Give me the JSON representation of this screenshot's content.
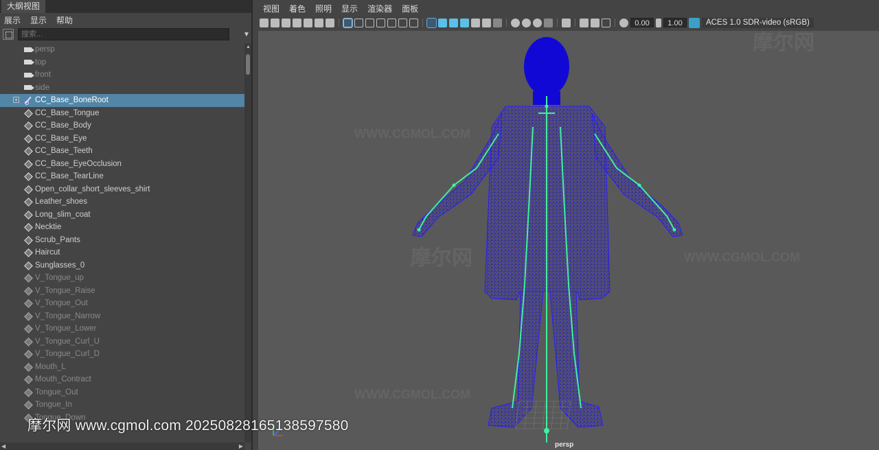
{
  "outliner": {
    "tab_title": "大纲视图",
    "menu": [
      "展示",
      "显示",
      "帮助"
    ],
    "search_placeholder": "搜索...",
    "items": [
      {
        "label": "persp",
        "type": "camera"
      },
      {
        "label": "top",
        "type": "camera"
      },
      {
        "label": "front",
        "type": "camera"
      },
      {
        "label": "side",
        "type": "camera"
      },
      {
        "label": "CC_Base_BoneRoot",
        "type": "joint",
        "selected": true,
        "expandable": true
      },
      {
        "label": "CC_Base_Tongue",
        "type": "mesh"
      },
      {
        "label": "CC_Base_Body",
        "type": "mesh"
      },
      {
        "label": "CC_Base_Eye",
        "type": "mesh"
      },
      {
        "label": "CC_Base_Teeth",
        "type": "mesh"
      },
      {
        "label": "CC_Base_EyeOcclusion",
        "type": "mesh"
      },
      {
        "label": "CC_Base_TearLine",
        "type": "mesh"
      },
      {
        "label": "Open_collar_short_sleeves_shirt",
        "type": "mesh"
      },
      {
        "label": "Leather_shoes",
        "type": "mesh"
      },
      {
        "label": "Long_slim_coat",
        "type": "mesh"
      },
      {
        "label": "Necktie",
        "type": "mesh"
      },
      {
        "label": "Scrub_Pants",
        "type": "mesh"
      },
      {
        "label": "Haircut",
        "type": "mesh"
      },
      {
        "label": "Sunglasses_0",
        "type": "mesh"
      },
      {
        "label": "V_Tongue_up",
        "type": "mesh",
        "dim": true
      },
      {
        "label": "V_Tongue_Raise",
        "type": "mesh",
        "dim": true
      },
      {
        "label": "V_Tongue_Out",
        "type": "mesh",
        "dim": true
      },
      {
        "label": "V_Tongue_Narrow",
        "type": "mesh",
        "dim": true
      },
      {
        "label": "V_Tongue_Lower",
        "type": "mesh",
        "dim": true
      },
      {
        "label": "V_Tongue_Curl_U",
        "type": "mesh",
        "dim": true
      },
      {
        "label": "V_Tongue_Curl_D",
        "type": "mesh",
        "dim": true
      },
      {
        "label": "Mouth_L",
        "type": "mesh",
        "dim": true
      },
      {
        "label": "Mouth_Contract",
        "type": "mesh",
        "dim": true
      },
      {
        "label": "Tongue_Out",
        "type": "mesh",
        "dim": true
      },
      {
        "label": "Tongue_In",
        "type": "mesh",
        "dim": true
      },
      {
        "label": "Tongue_Down",
        "type": "mesh",
        "dim": true
      }
    ]
  },
  "viewport": {
    "menu": [
      "视图",
      "着色",
      "照明",
      "显示",
      "渲染器",
      "面板"
    ],
    "exposure": "0.00",
    "gamma": "1.00",
    "colorspace": "ACES 1.0 SDR-video (sRGB)",
    "camera_label": "persp"
  },
  "colors": {
    "selection": "#5285a6",
    "wireframe": "#1a0dd9",
    "joints": "#40f0a0"
  },
  "watermark": {
    "logo": "摩尔网",
    "site": "WWW.CGMOL.COM",
    "bottom_text": "摩尔网 www.cgmol.com 20250828165138597580"
  }
}
